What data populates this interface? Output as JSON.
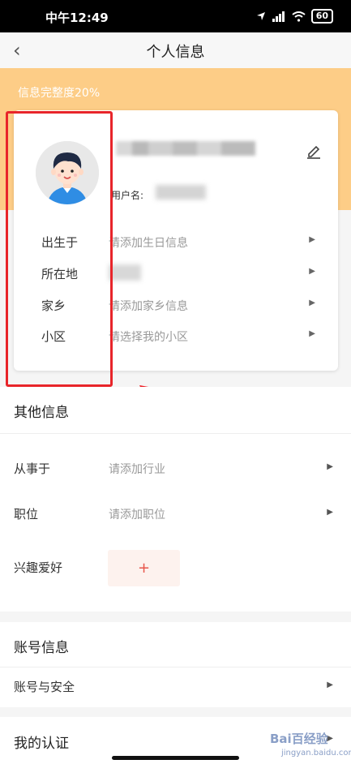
{
  "status_bar": {
    "time": "中午12:49",
    "battery": "60"
  },
  "nav": {
    "title": "个人信息"
  },
  "banner": {
    "completeness_text": "信息完整度20%"
  },
  "profile": {
    "username_label": "用户名:",
    "rows": [
      {
        "label": "出生于",
        "value": "请添加生日信息"
      },
      {
        "label": "所在地",
        "value": ""
      },
      {
        "label": "家乡",
        "value": "请添加家乡信息"
      },
      {
        "label": "小区",
        "value": "请选择我的小区"
      }
    ]
  },
  "other_info": {
    "title": "其他信息",
    "rows": [
      {
        "label": "从事于",
        "value": "请添加行业"
      },
      {
        "label": "职位",
        "value": "请添加职位"
      }
    ],
    "hobby_label": "兴趣爱好",
    "hobby_add": "+"
  },
  "account": {
    "title": "账号信息",
    "security_label": "账号与安全"
  },
  "certification": {
    "title": "我的认证"
  },
  "watermark": {
    "text": "Bai百经验",
    "sub": "jingyan.baidu.com"
  }
}
